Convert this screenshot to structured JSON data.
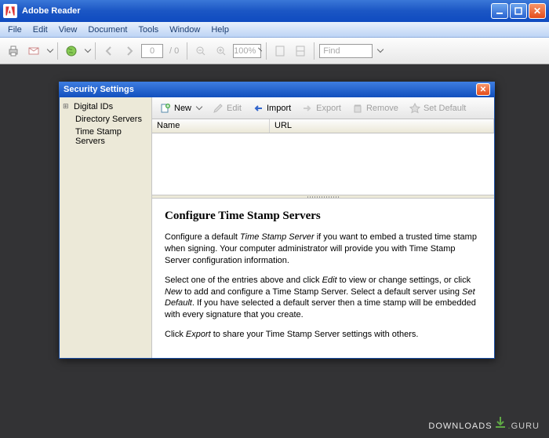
{
  "app": {
    "title": "Adobe Reader",
    "menu": [
      "File",
      "Edit",
      "View",
      "Document",
      "Tools",
      "Window",
      "Help"
    ],
    "page_current": "0",
    "page_total": "/ 0",
    "zoom": "100%",
    "find_placeholder": "Find"
  },
  "dialog": {
    "title": "Security Settings",
    "tree": [
      "Digital IDs",
      "Directory Servers",
      "Time Stamp Servers"
    ],
    "toolbar": {
      "new": "New",
      "edit": "Edit",
      "import": "Import",
      "export": "Export",
      "remove": "Remove",
      "set_default": "Set Default"
    },
    "columns": {
      "name": "Name",
      "url": "URL"
    },
    "help": {
      "heading": "Configure Time Stamp Servers",
      "p1a": "Configure a default ",
      "p1i1": "Time Stamp Server",
      "p1b": " if you want to embed a trusted time stamp when signing. Your computer administrator will provide you with Time Stamp Server configuration information.",
      "p2a": "Select one of the entries above and click ",
      "p2i1": "Edit",
      "p2b": " to view or change settings, or click ",
      "p2i2": "New",
      "p2c": " to add and configure a Time Stamp Server. Select a default server using ",
      "p2i3": "Set Default",
      "p2d": ". If you have selected a default server then a time stamp will be embedded with every signature that you create.",
      "p3a": "Click ",
      "p3i1": "Export",
      "p3b": " to share your Time Stamp Server settings with others."
    }
  },
  "watermark": {
    "a": "DOWNLOADS",
    "b": ".",
    "c": "GURU"
  }
}
